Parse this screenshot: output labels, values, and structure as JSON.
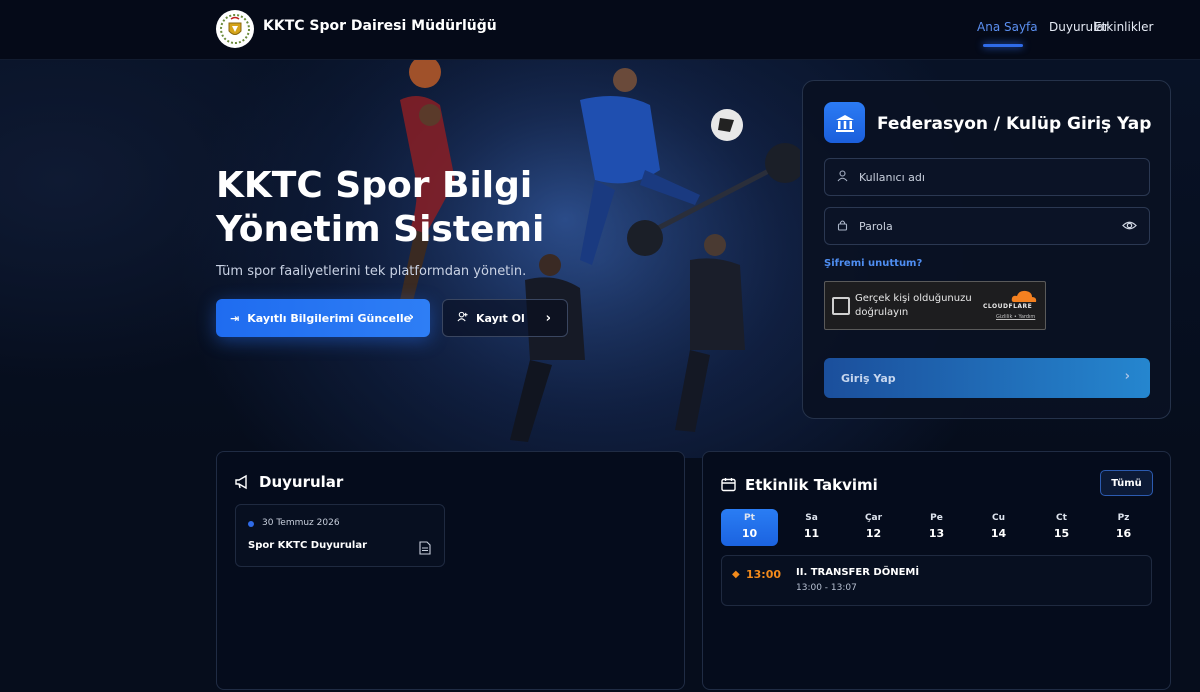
{
  "header": {
    "brand": "KKTC Spor Dairesi Müdürlüğü",
    "logo_icon": "crest-emblem-icon",
    "nav": [
      {
        "label": "Ana Sayfa",
        "active": true
      },
      {
        "label": "Duyurular",
        "active": false
      },
      {
        "label": "Etkinlikler",
        "active": false
      }
    ]
  },
  "hero": {
    "title_line1": "KKTC Spor Bilgi",
    "title_line2": "Yönetim Sistemi",
    "subtitle": "Tüm spor faaliyetlerini tek platformdan yönetin.",
    "primary_button": "Kayıtlı Bilgilerimi Güncelle",
    "secondary_button": "Kayıt Ol"
  },
  "login": {
    "title": "Federasyon / Kulüp Giriş Yap",
    "username_placeholder": "Kullanıcı adı",
    "password_placeholder": "Parola",
    "forgot": "Şifremi unuttum?",
    "captcha_text": "Gerçek kişi olduğunuzu doğrulayın",
    "captcha_brand": "CLOUDFLARE",
    "captcha_links": "Gizlilik • Yardım",
    "submit": "Giriş Yap"
  },
  "announcements": {
    "title": "Duyurular",
    "items": [
      {
        "date": "30 Temmuz 2026",
        "title": "Spor KKTC Duyurular"
      }
    ]
  },
  "calendar": {
    "title": "Etkinlik Takvimi",
    "all_button": "Tümü",
    "days": [
      {
        "name": "Pt",
        "date": "10",
        "selected": true
      },
      {
        "name": "Sa",
        "date": "11",
        "selected": false
      },
      {
        "name": "Çar",
        "date": "12",
        "selected": false
      },
      {
        "name": "Pe",
        "date": "13",
        "selected": false
      },
      {
        "name": "Cu",
        "date": "14",
        "selected": false
      },
      {
        "name": "Ct",
        "date": "15",
        "selected": false
      },
      {
        "name": "Pz",
        "date": "16",
        "selected": false
      }
    ],
    "events": [
      {
        "time": "13:00",
        "title": "II. TRANSFER DÖNEMİ",
        "range": "13:00 - 13:07"
      }
    ]
  },
  "colors": {
    "accent": "#2f6be8",
    "event_time": "#f28a1b",
    "background": "#060d1c"
  }
}
